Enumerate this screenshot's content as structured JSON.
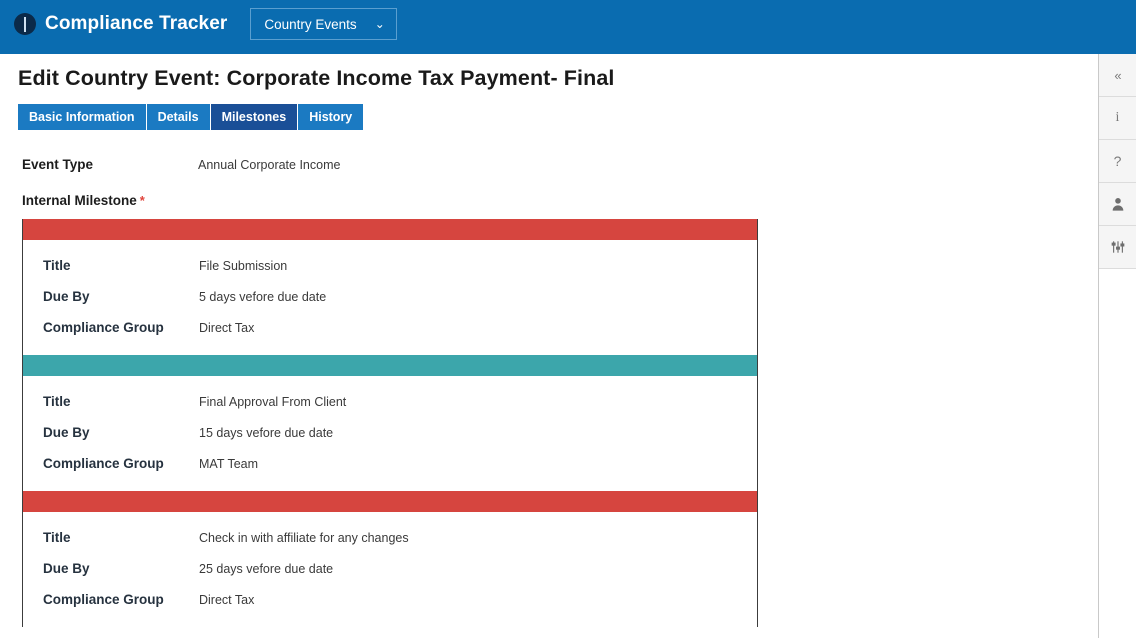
{
  "header": {
    "logo_icon": "circle-pin-icon",
    "app_title": "Compliance Tracker",
    "module_select": {
      "label": "Country Events",
      "caret_icon": "chevron-down-icon",
      "caret_glyph": "⌄"
    },
    "brand_color": "#0a6cb0"
  },
  "page": {
    "title": "Edit Country Event: Corporate Income Tax Payment- Final",
    "tabs": [
      {
        "label": "Basic Information",
        "active": false
      },
      {
        "label": "Details",
        "active": false
      },
      {
        "label": "Milestones",
        "active": true
      },
      {
        "label": "History",
        "active": false
      }
    ],
    "tab_color": "#1b7ac2",
    "tab_active_color": "#1a4f97"
  },
  "form": {
    "event_type": {
      "label": "Event Type",
      "value": "Annual Corporate Income"
    },
    "internal_milestone": {
      "label": "Internal Milestone",
      "required_marker": "*"
    }
  },
  "milestones": {
    "row_labels": {
      "title": "Title",
      "due_by": "Due By",
      "compliance_group": "Compliance Group"
    },
    "bar_colors": {
      "red": "#d6453f",
      "teal": "#3ca6ab"
    },
    "items": [
      {
        "bar_color": "#d6453f",
        "title": "File Submission",
        "due_by": "5 days vefore due date",
        "compliance_group": "Direct Tax"
      },
      {
        "bar_color": "#3ca6ab",
        "title": "Final Approval From Client",
        "due_by": "15 days vefore due date",
        "compliance_group": "MAT Team"
      },
      {
        "bar_color": "#d6453f",
        "title": "Check in with affiliate for any changes",
        "due_by": "25 days vefore due date",
        "compliance_group": "Direct Tax"
      }
    ]
  },
  "right_rail": {
    "buttons": [
      {
        "icon": "collapse-panel-icon",
        "glyph": "«"
      },
      {
        "icon": "info-icon",
        "glyph": "i"
      },
      {
        "icon": "help-icon",
        "glyph": "?"
      },
      {
        "icon": "user-icon",
        "glyph": ""
      },
      {
        "icon": "sliders-settings-icon",
        "glyph": ""
      }
    ]
  }
}
